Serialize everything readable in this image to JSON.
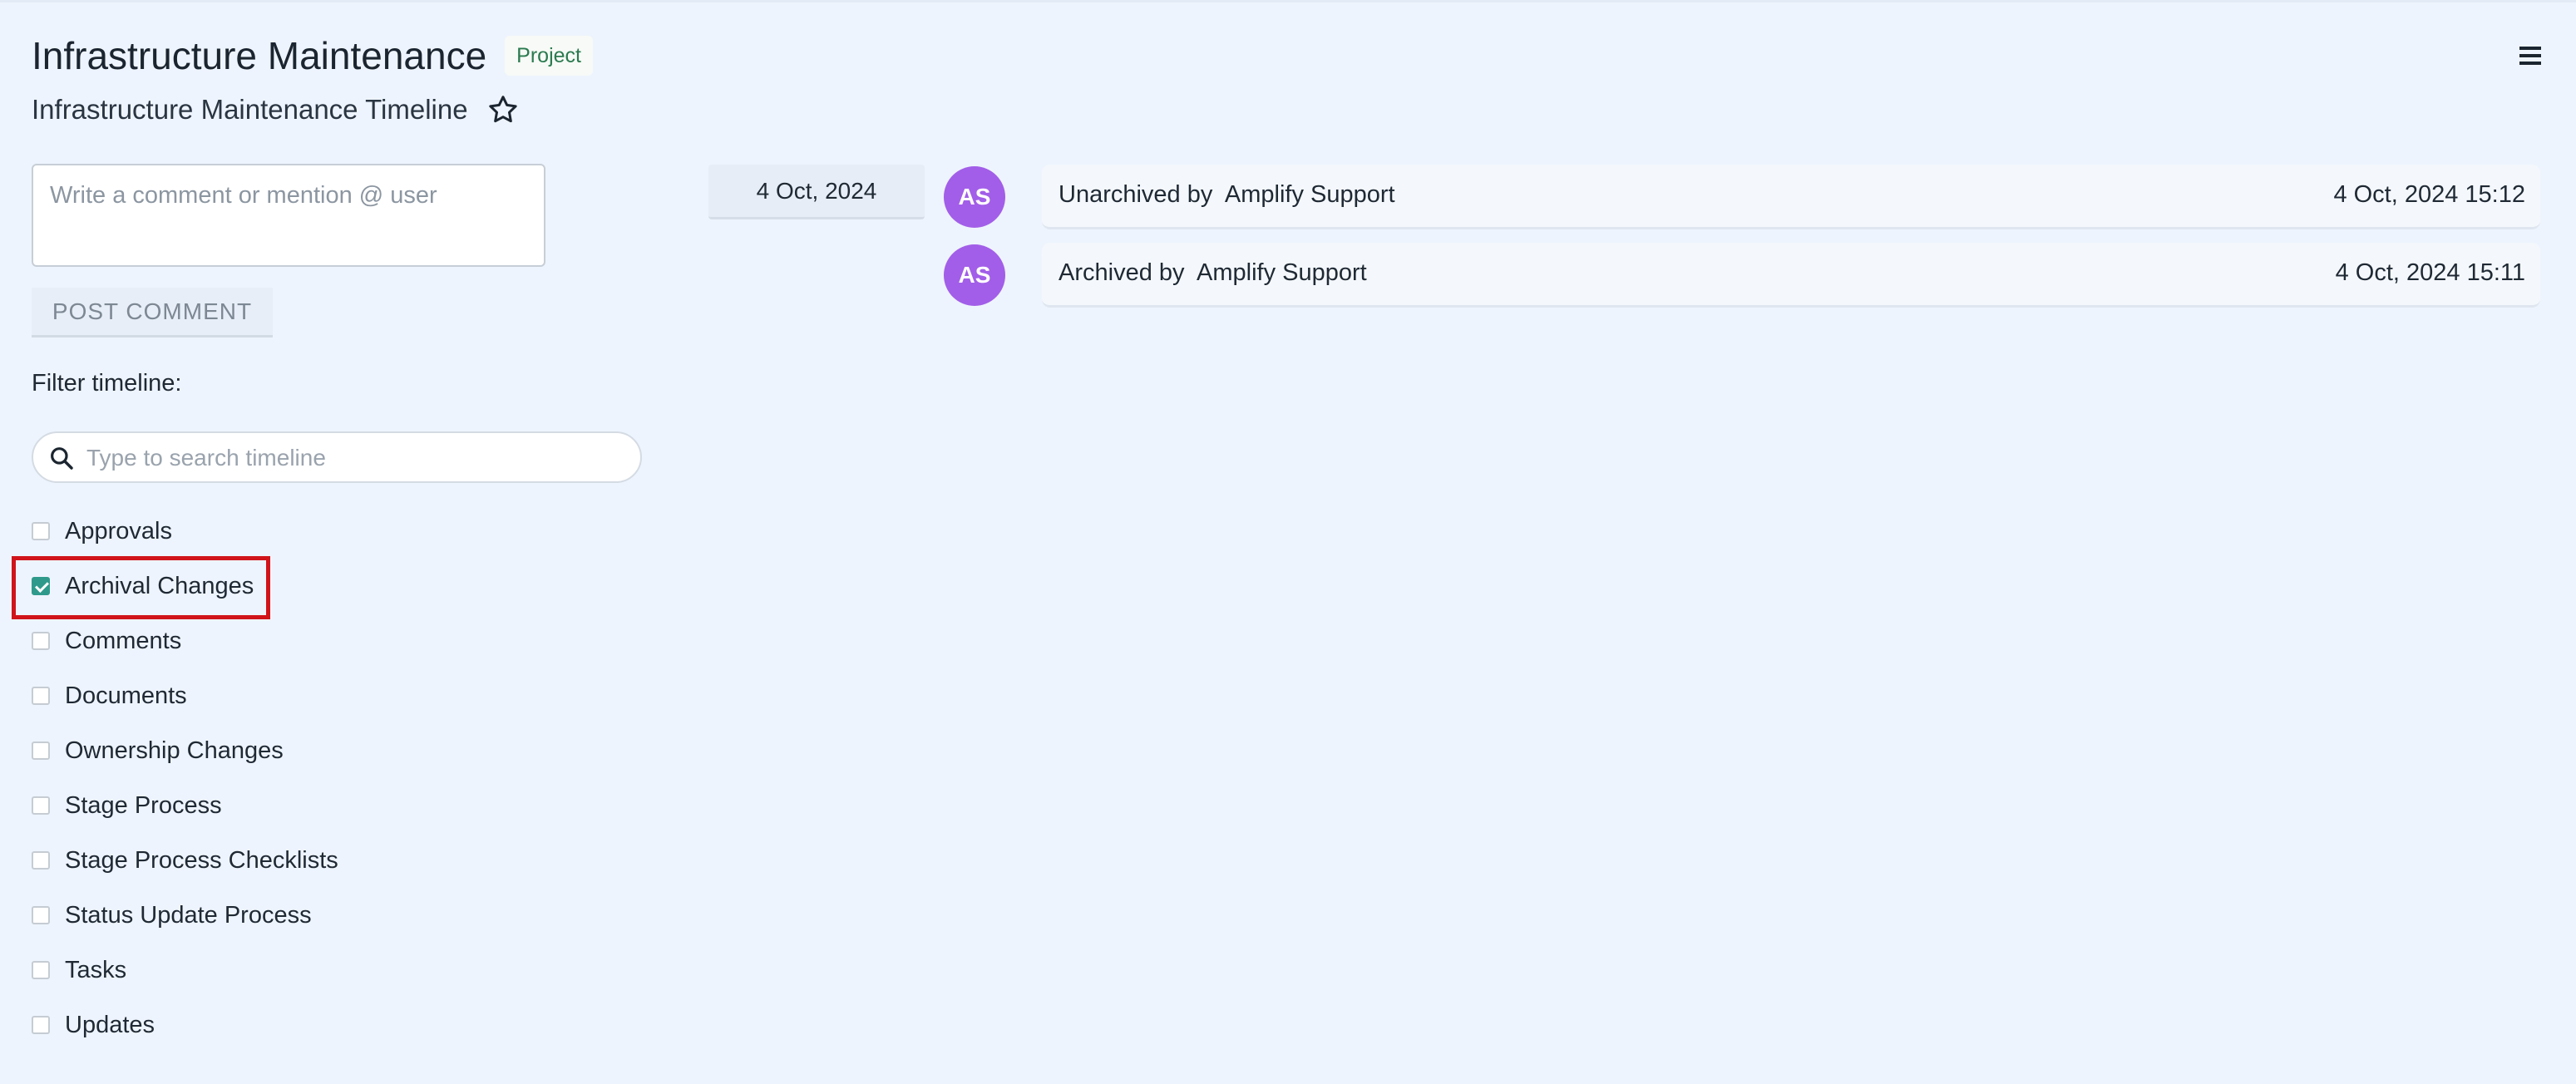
{
  "header": {
    "title": "Infrastructure Maintenance",
    "badge": "Project",
    "subtitle": "Infrastructure Maintenance Timeline"
  },
  "comment": {
    "placeholder": "Write a comment or mention @ user",
    "post_label": "POST COMMENT"
  },
  "filter": {
    "label": "Filter timeline:",
    "search_placeholder": "Type to search timeline",
    "items": [
      {
        "label": "Approvals",
        "checked": false
      },
      {
        "label": "Archival Changes",
        "checked": true
      },
      {
        "label": "Comments",
        "checked": false
      },
      {
        "label": "Documents",
        "checked": false
      },
      {
        "label": "Ownership Changes",
        "checked": false
      },
      {
        "label": "Stage Process",
        "checked": false
      },
      {
        "label": "Stage Process Checklists",
        "checked": false
      },
      {
        "label": "Status Update Process",
        "checked": false
      },
      {
        "label": "Tasks",
        "checked": false
      },
      {
        "label": "Updates",
        "checked": false
      }
    ]
  },
  "timeline": {
    "date": "4 Oct, 2024",
    "entries": [
      {
        "initials": "AS",
        "text": "Unarchived by  Amplify Support",
        "time": "4 Oct, 2024 15:12"
      },
      {
        "initials": "AS",
        "text": "Archived by  Amplify Support",
        "time": "4 Oct, 2024 15:11"
      }
    ]
  },
  "colors": {
    "background": "#eef4fd",
    "avatar": "#a25ee8",
    "checkbox_checked": "#2f9a8c",
    "highlight": "#d0141a",
    "badge_text": "#2b7a50"
  },
  "icons": [
    "star-icon",
    "menu-icon",
    "search-icon"
  ]
}
